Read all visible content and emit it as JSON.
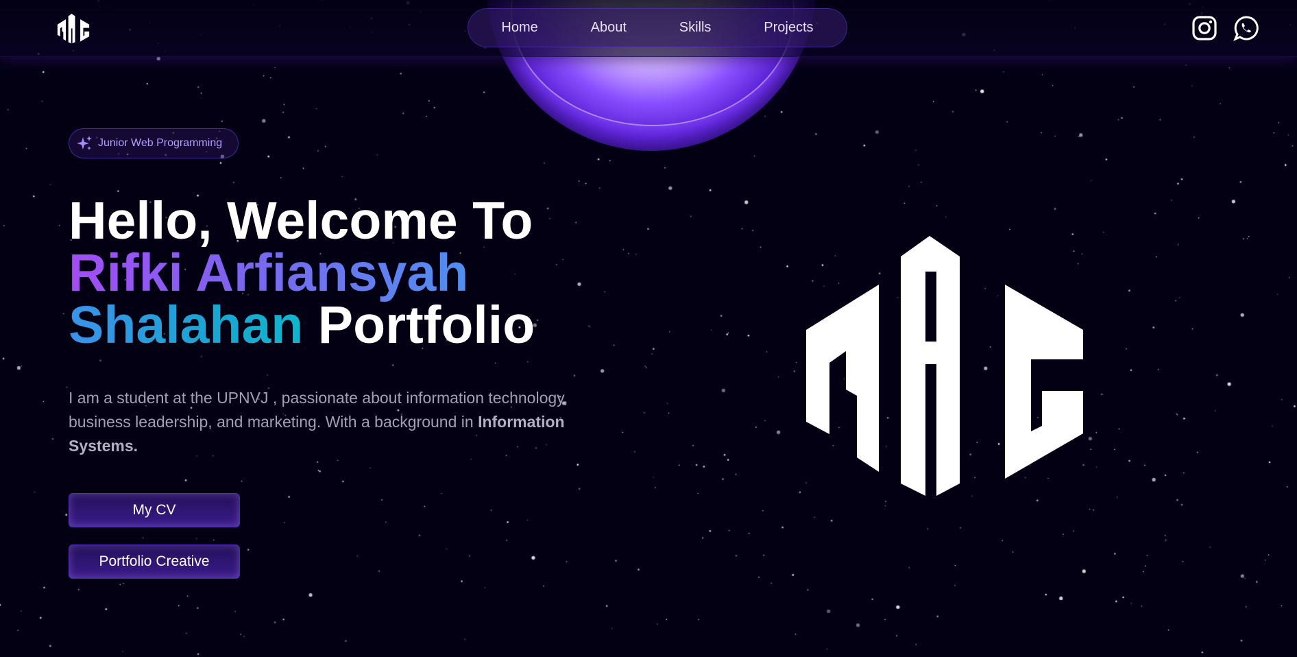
{
  "brand": {
    "logo_text": "RAS"
  },
  "nav": {
    "links": [
      {
        "label": "Home"
      },
      {
        "label": "About"
      },
      {
        "label": "Skills"
      },
      {
        "label": "Projects"
      }
    ]
  },
  "social": {
    "icons": [
      "instagram-icon",
      "whatsapp-icon"
    ]
  },
  "hero": {
    "badge": "Junior Web Programming",
    "headline": {
      "line1": "Hello, Welcome To",
      "line2": "Rifki Arfiansyah",
      "line3_name": "Shalahan",
      "line3_rest": "Portfolio"
    },
    "intro": "I am a student at the UPNVJ , passionate about information technology, business leadership, and marketing. With a background in ",
    "intro_bold": "Information Systems.",
    "buttons": {
      "cv": "My CV",
      "creative": "Portfolio Creative"
    }
  },
  "colors": {
    "background": "#030014",
    "accent_purple": "#7042f8",
    "gradient_start": "#a34df5",
    "gradient_end": "#10b5cc"
  }
}
